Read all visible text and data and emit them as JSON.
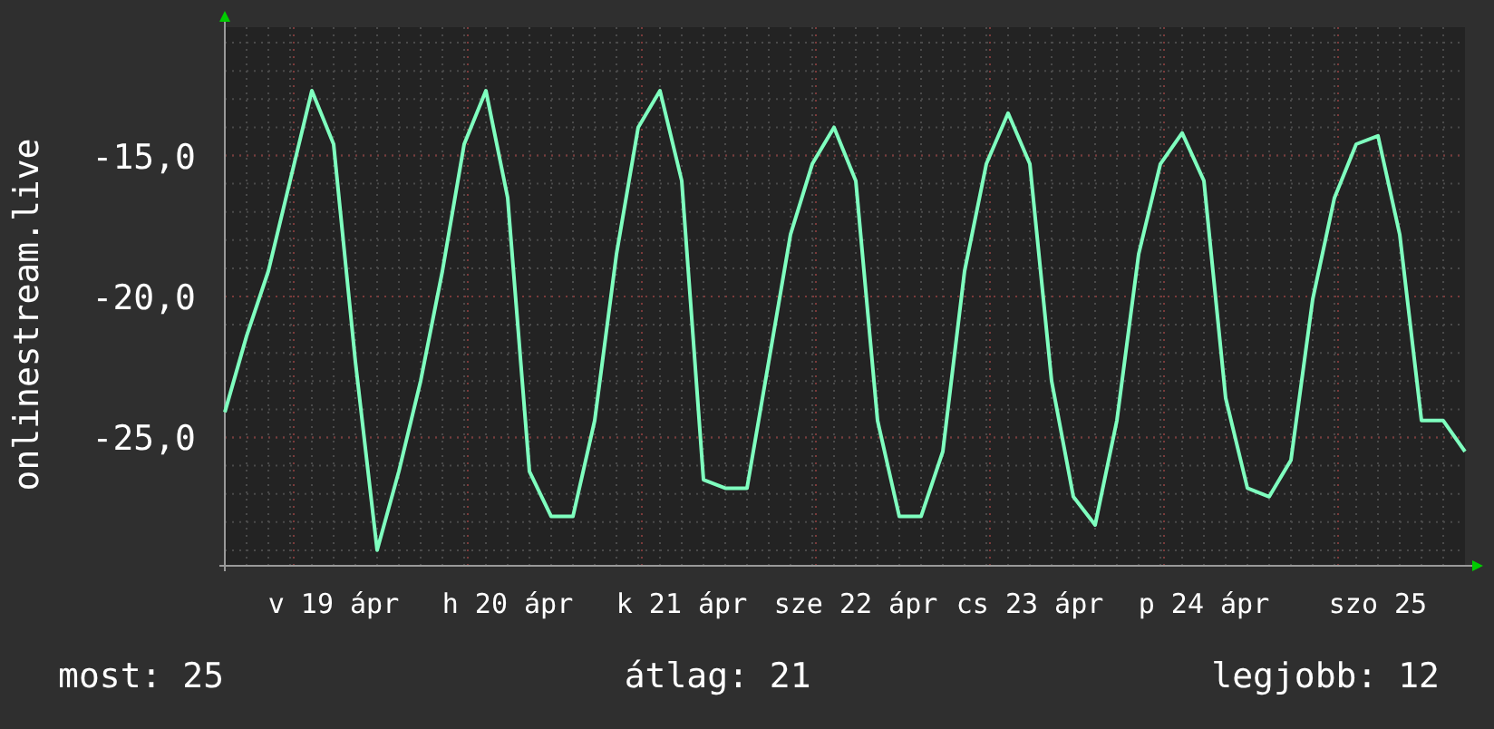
{
  "chart_data": {
    "type": "line",
    "ylabel": "onlinestream.live",
    "ylim": [
      -29.55,
      -10.45
    ],
    "yticks": [
      {
        "value": -15,
        "label": "-15,0"
      },
      {
        "value": -20,
        "label": "-20,0"
      },
      {
        "value": -25,
        "label": "-25,0"
      }
    ],
    "grid": true,
    "categories": [
      null,
      null,
      null,
      null,
      null,
      "v 19 ápr",
      null,
      null,
      null,
      null,
      null,
      null,
      null,
      "h 20 ápr",
      null,
      null,
      null,
      null,
      null,
      null,
      null,
      "k 21 ápr",
      null,
      null,
      null,
      null,
      null,
      null,
      null,
      "sze 22 ápr",
      null,
      null,
      null,
      null,
      null,
      null,
      null,
      "cs 23 ápr",
      null,
      null,
      null,
      null,
      null,
      null,
      null,
      "p 24 ápr",
      null,
      null,
      null,
      null,
      null,
      null,
      null,
      "szo 25",
      null,
      null,
      null,
      null
    ],
    "series": [
      {
        "color": "#7fffbf",
        "values": [
          -24.1,
          -21.4,
          -19.1,
          -15.9,
          -12.7,
          -14.6,
          -22.3,
          -29.0,
          -26.2,
          -23.0,
          -19.1,
          -14.6,
          -12.7,
          -16.5,
          -26.2,
          -27.8,
          -27.8,
          -24.4,
          -18.5,
          -14.0,
          -12.7,
          -15.9,
          -26.5,
          -26.8,
          -26.8,
          -22.3,
          -17.8,
          -15.3,
          -14.0,
          -15.9,
          -24.4,
          -27.8,
          -27.8,
          -25.5,
          -19.1,
          -15.3,
          -13.5,
          -15.3,
          -23.0,
          -27.1,
          -28.1,
          -24.4,
          -18.5,
          -15.3,
          -14.2,
          -15.9,
          -23.6,
          -26.8,
          -27.1,
          -25.8,
          -20.1,
          -16.5,
          -14.6,
          -14.3,
          -17.8,
          -24.4,
          -24.4,
          -25.5
        ]
      }
    ]
  },
  "legend": [
    {
      "text": "most: 25"
    },
    {
      "text": "átlag: 21"
    },
    {
      "text": "legjobb: 12"
    }
  ]
}
